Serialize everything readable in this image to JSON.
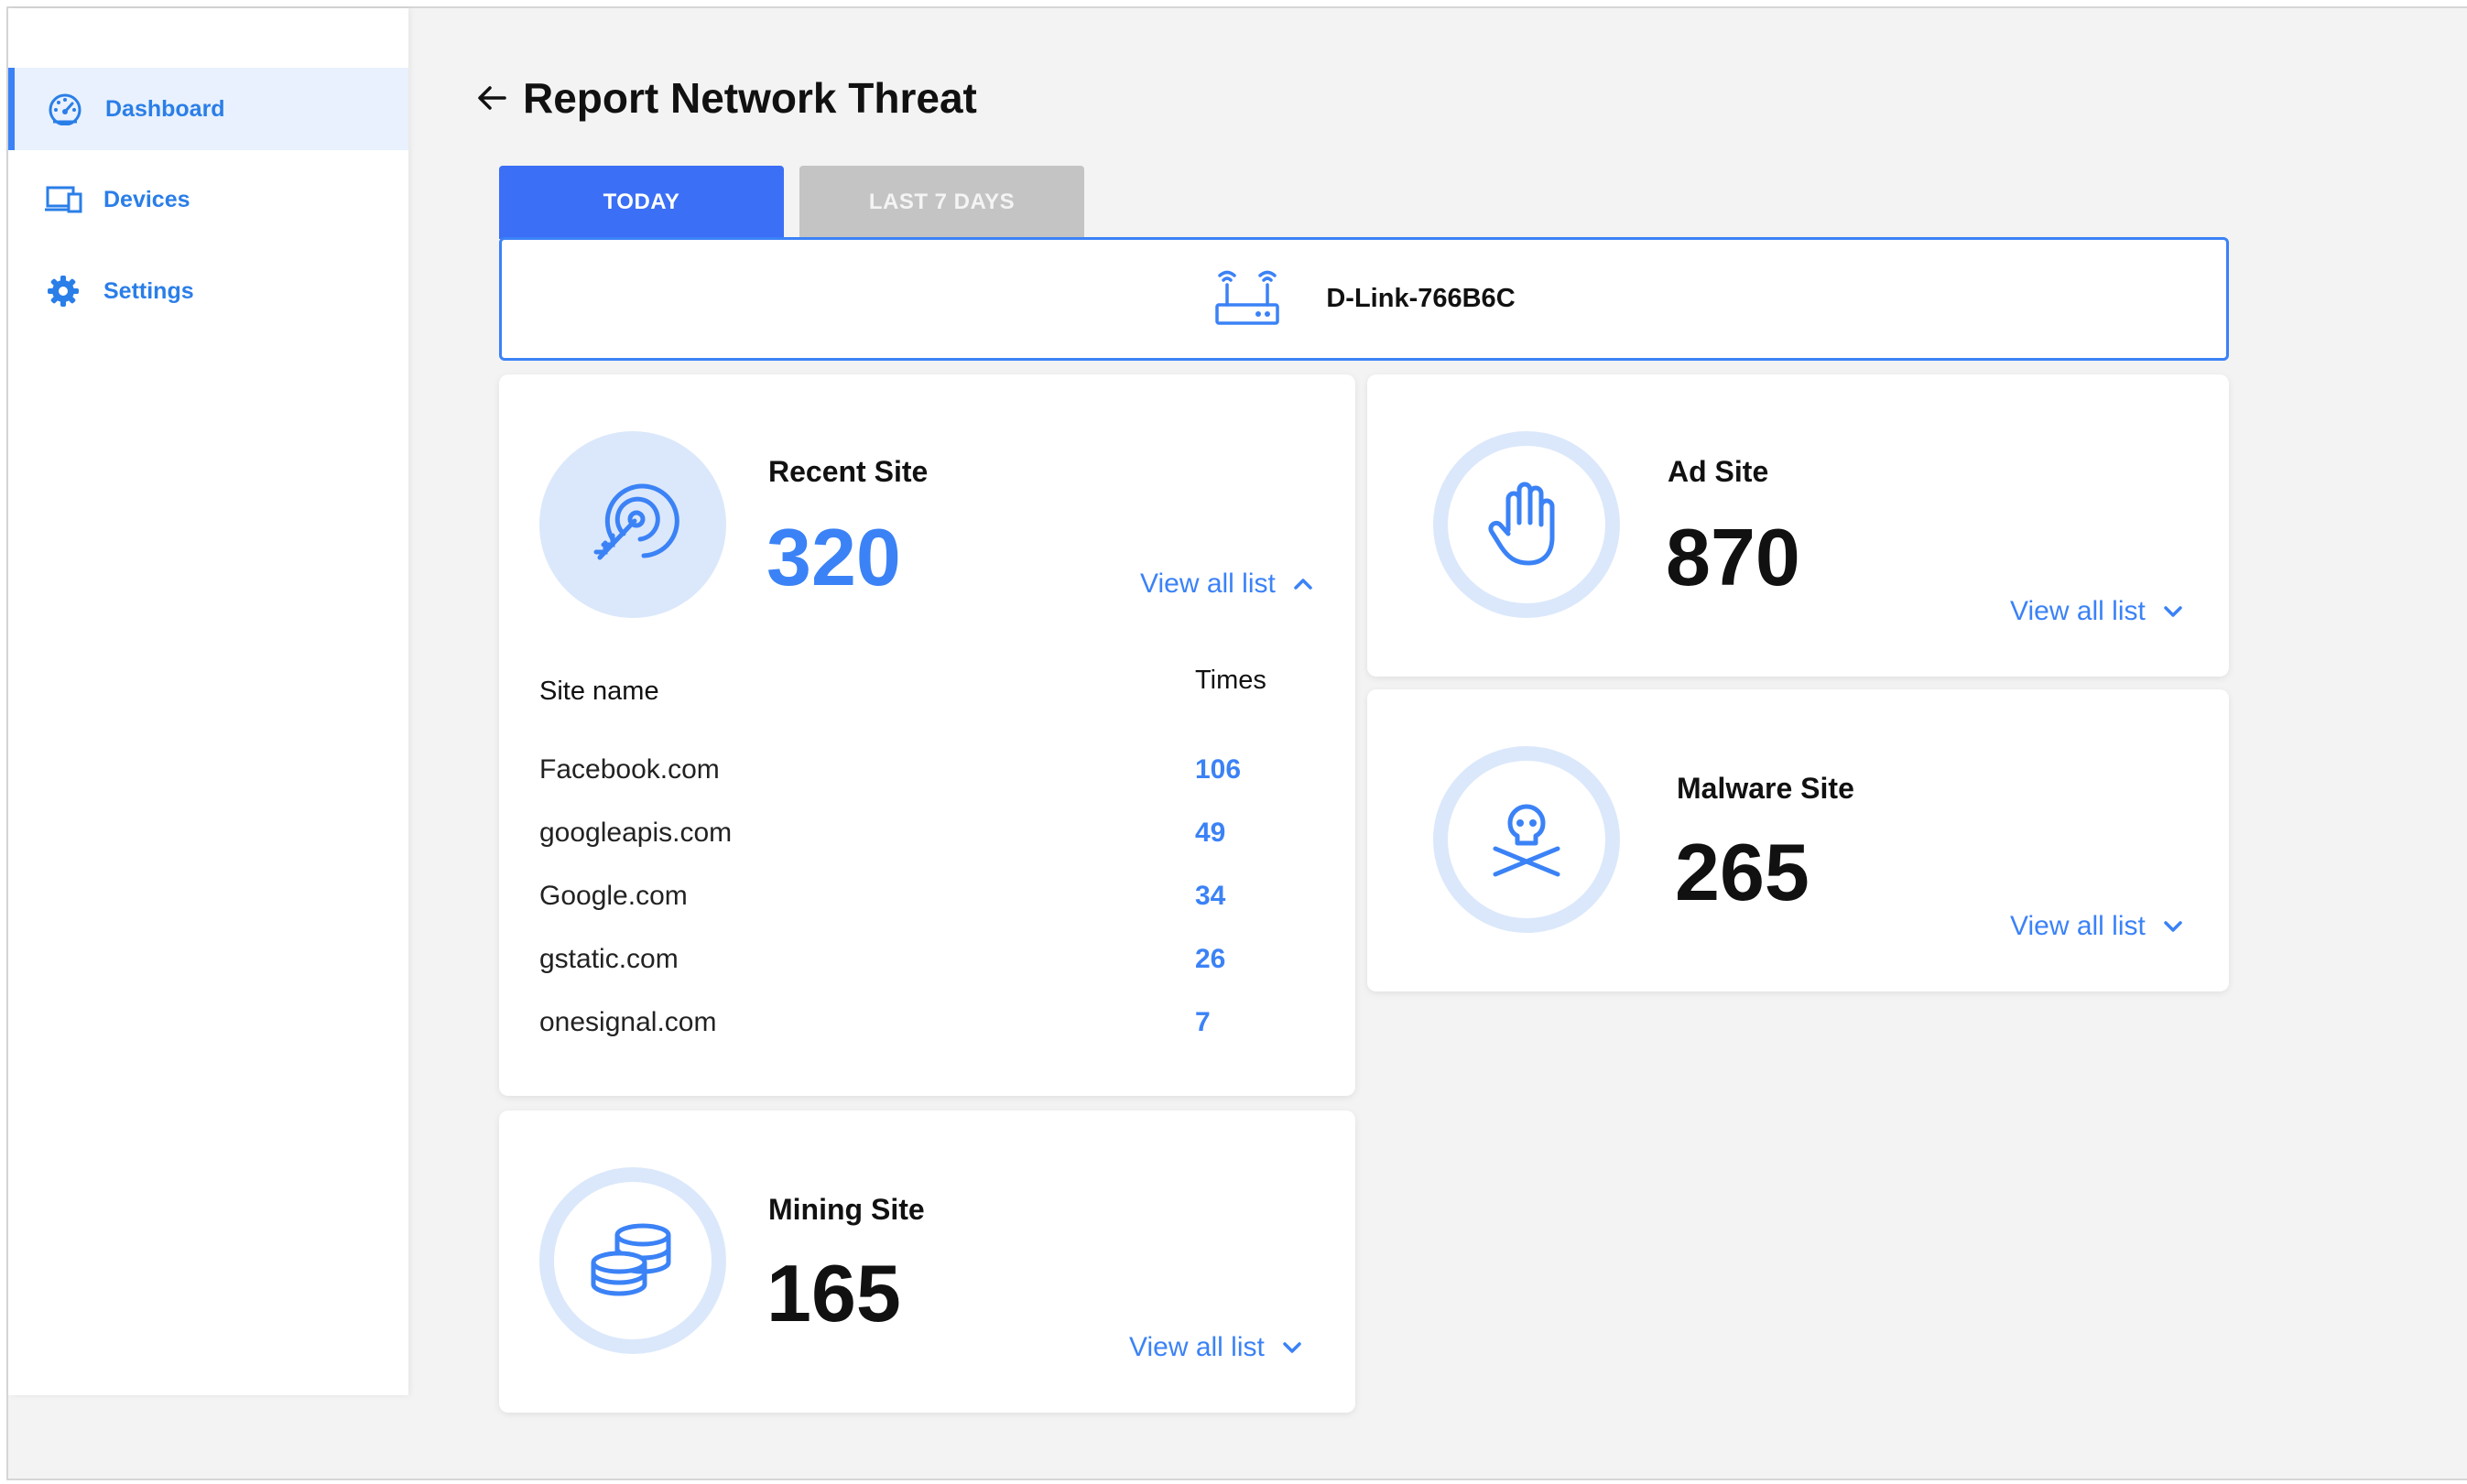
{
  "sidebar": {
    "items": [
      {
        "label": "Dashboard",
        "icon": "gauge-icon",
        "active": true
      },
      {
        "label": "Devices",
        "icon": "devices-icon",
        "active": false
      },
      {
        "label": "Settings",
        "icon": "gear-icon",
        "active": false
      }
    ]
  },
  "header": {
    "title": "Report Network Threat"
  },
  "tabs": [
    {
      "label": "TODAY",
      "active": true
    },
    {
      "label": "LAST 7 DAYS",
      "active": false
    }
  ],
  "device": {
    "name": "D-Link-766B6C",
    "icon": "router-icon"
  },
  "cards": {
    "recent": {
      "label": "Recent Site",
      "value": "320",
      "view_all": "View all list",
      "expanded": true,
      "table": {
        "col_site": "Site name",
        "col_times": "Times",
        "rows": [
          {
            "site": "Facebook.com",
            "times": "106"
          },
          {
            "site": "googleapis.com",
            "times": "49"
          },
          {
            "site": "Google.com",
            "times": "34"
          },
          {
            "site": "gstatic.com",
            "times": "26"
          },
          {
            "site": "onesignal.com",
            "times": "7"
          }
        ]
      }
    },
    "ad": {
      "label": "Ad Site",
      "value": "870",
      "view_all": "View all list"
    },
    "malware": {
      "label": "Malware Site",
      "value": "265",
      "view_all": "View all list"
    },
    "mining": {
      "label": "Mining Site",
      "value": "165",
      "view_all": "View all list"
    }
  },
  "colors": {
    "accent": "#3b82f6",
    "tab_active": "#3b6ff5",
    "tab_inactive": "#c4c4c4",
    "icon_bg": "#dbe8fb"
  }
}
